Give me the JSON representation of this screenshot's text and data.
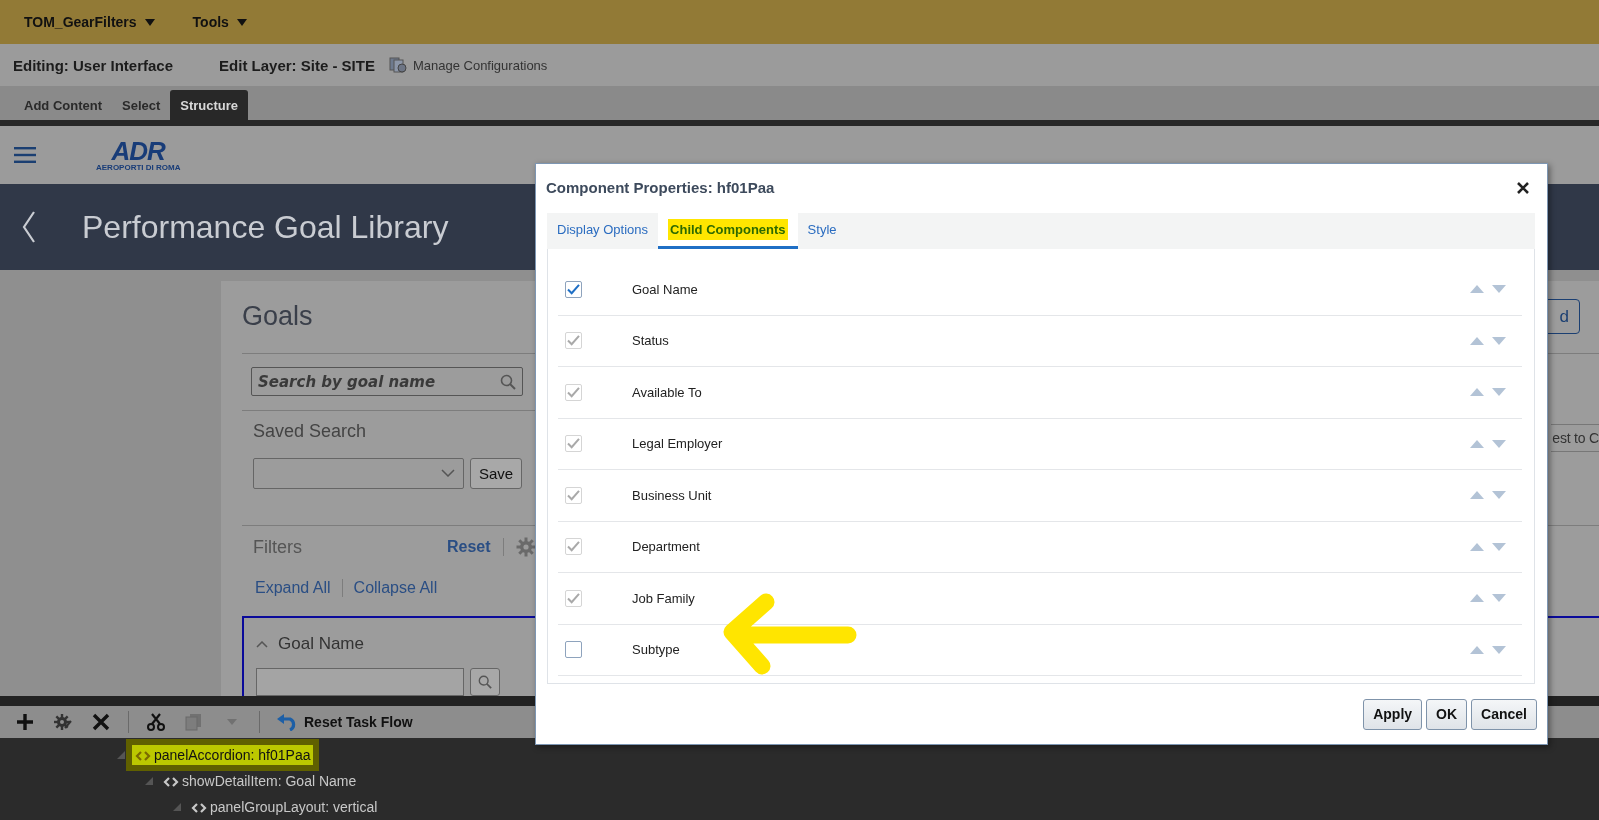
{
  "menu_bar": {
    "items": [
      {
        "label": "TOM_GearFilters"
      },
      {
        "label": "Tools"
      }
    ]
  },
  "edit_bar": {
    "editing": "Editing: User Interface",
    "edit_layer": "Edit Layer: Site - SITE",
    "manage_link": "Manage Configurations"
  },
  "mode_tabs": [
    {
      "label": "Add Content",
      "selected": false
    },
    {
      "label": "Select",
      "selected": false
    },
    {
      "label": "Structure",
      "selected": true
    }
  ],
  "app": {
    "logo": {
      "mark": "ADR",
      "subtitle": "AEROPORTI DI ROMA"
    },
    "title": "Performance Goal Library"
  },
  "goals": {
    "title": "Goals",
    "button_partial": "d",
    "search_placeholder": "Search by goal name",
    "saved_search_label": "Saved Search",
    "side_text_partial": "est to C",
    "save_button": "Save",
    "filters_label": "Filters",
    "reset_link": "Reset",
    "expand_all": "Expand All",
    "collapse_all": "Collapse All",
    "filter_section": "Goal Name"
  },
  "toolbar": {
    "reset_task_flow": "Reset Task Flow"
  },
  "tree": [
    {
      "label": "panelAccordion: hf01Paa",
      "expanded": true,
      "highlighted": true,
      "children": [
        {
          "label": "showDetailItem: Goal Name",
          "expanded": true,
          "highlighted": false,
          "children": [
            {
              "label": "panelGroupLayout: vertical",
              "expanded": true,
              "highlighted": false
            }
          ]
        }
      ]
    }
  ],
  "dialog": {
    "title": "Component Properties: hf01Paa",
    "tabs": [
      {
        "label": "Display Options",
        "selected": false,
        "highlighted": false
      },
      {
        "label": "Child Components",
        "selected": true,
        "highlighted": true
      },
      {
        "label": "Style",
        "selected": false,
        "highlighted": false
      }
    ],
    "rows": [
      {
        "label": "Goal Name",
        "checked": true,
        "disabled": false
      },
      {
        "label": "Status",
        "checked": true,
        "disabled": true
      },
      {
        "label": "Available To",
        "checked": true,
        "disabled": true
      },
      {
        "label": "Legal Employer",
        "checked": true,
        "disabled": true
      },
      {
        "label": "Business Unit",
        "checked": true,
        "disabled": true
      },
      {
        "label": "Department",
        "checked": true,
        "disabled": true
      },
      {
        "label": "Job Family",
        "checked": true,
        "disabled": true
      },
      {
        "label": "Subtype",
        "checked": false,
        "disabled": false
      }
    ],
    "buttons": [
      "Apply",
      "OK",
      "Cancel"
    ]
  }
}
